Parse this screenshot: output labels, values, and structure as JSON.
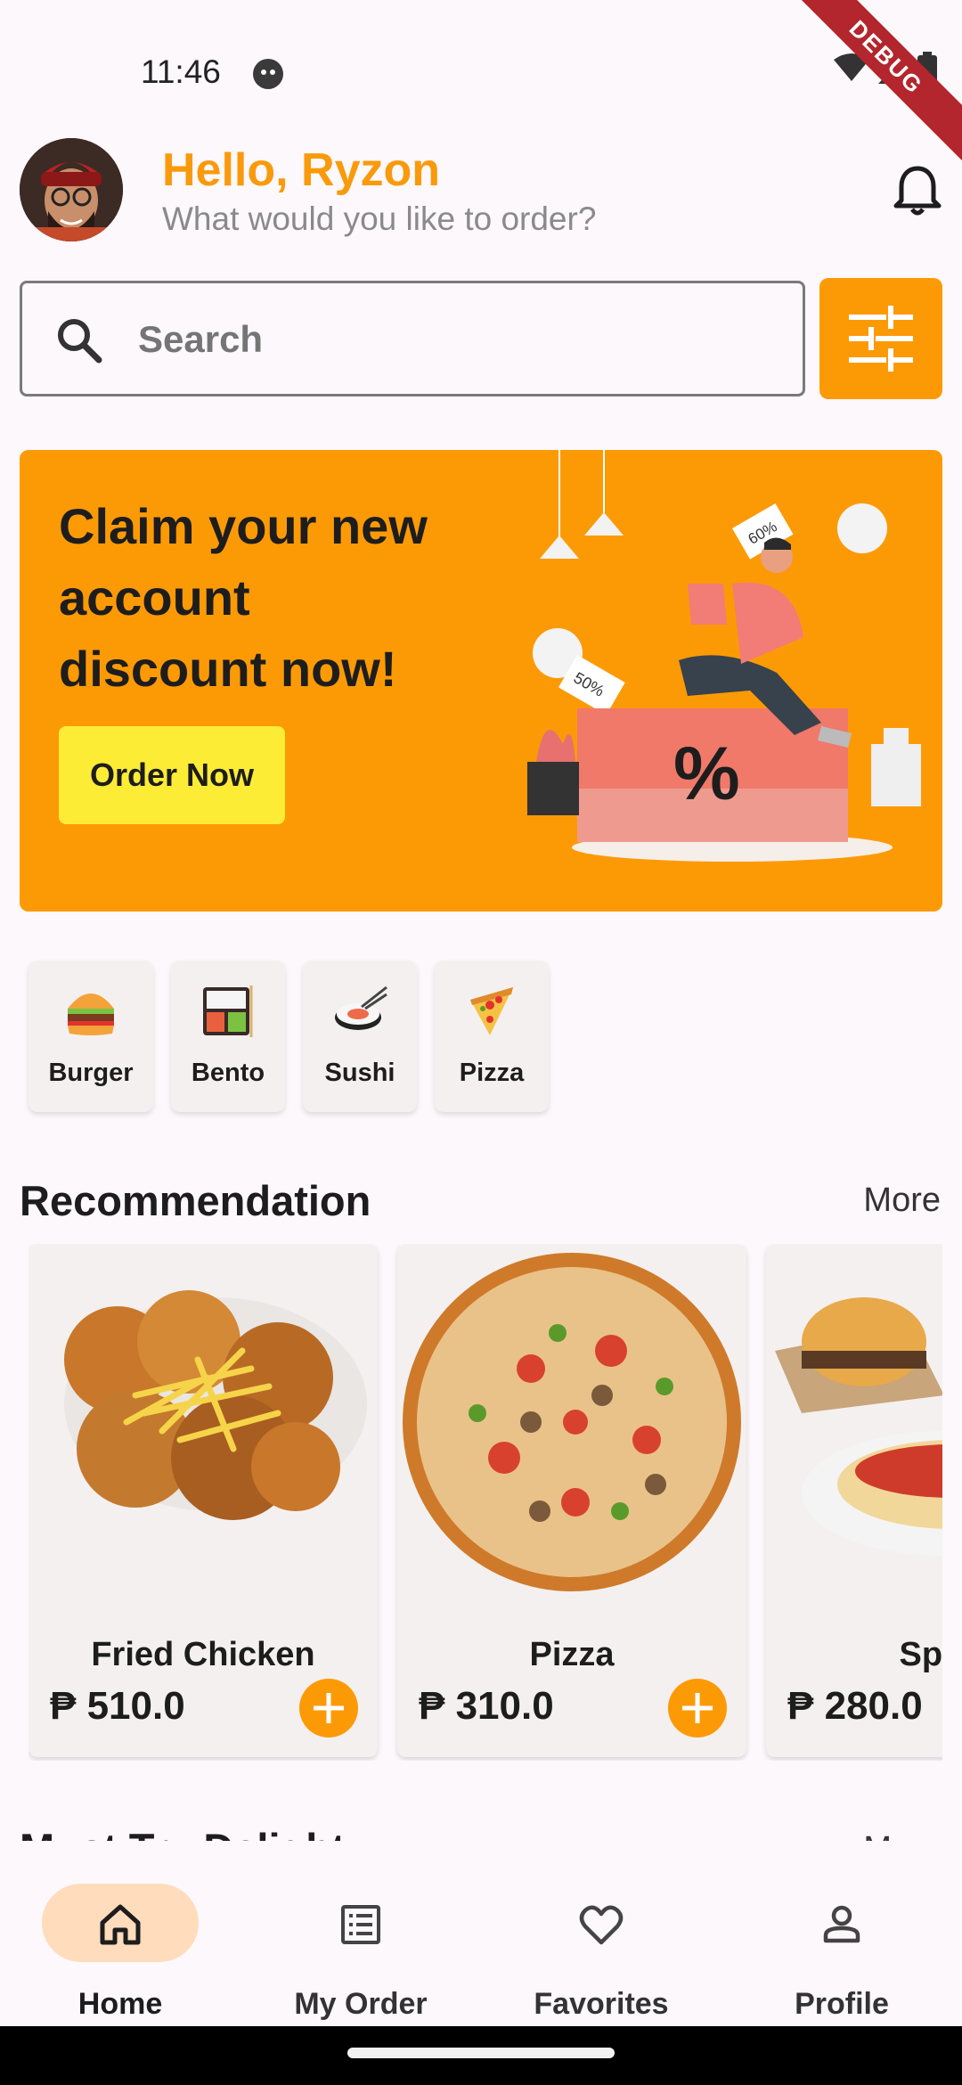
{
  "status_bar": {
    "time": "11:46",
    "debug_label": "DEBUG"
  },
  "header": {
    "greeting": "Hello, Ryzon",
    "subtitle": "What would you like to order?"
  },
  "search": {
    "placeholder": "Search"
  },
  "banner": {
    "title": "Claim your new account discount now!",
    "button_label": "Order Now",
    "tag_60": "60%",
    "tag_50": "50%",
    "percent_sign": "%"
  },
  "categories": [
    {
      "label": "Burger",
      "icon": "burger-icon"
    },
    {
      "label": "Bento",
      "icon": "bento-icon"
    },
    {
      "label": "Sushi",
      "icon": "sushi-icon"
    },
    {
      "label": "Pizza",
      "icon": "pizza-icon"
    }
  ],
  "recommendation": {
    "title": "Recommendation",
    "more_label": "More",
    "items": [
      {
        "name": "Fried Chicken",
        "price": "₱ 510.0"
      },
      {
        "name": "Pizza",
        "price": "₱ 310.0"
      },
      {
        "name": "Spag",
        "price": "₱ 280.0"
      }
    ]
  },
  "must_try": {
    "title": "Must Try Delight",
    "more_label": "More"
  },
  "bottom_nav": [
    {
      "label": "Home",
      "icon": "home-icon",
      "active": true
    },
    {
      "label": "My Order",
      "icon": "order-list-icon",
      "active": false
    },
    {
      "label": "Favorites",
      "icon": "heart-icon",
      "active": false
    },
    {
      "label": "Profile",
      "icon": "person-icon",
      "active": false
    }
  ],
  "colors": {
    "accent": "#fc9a06",
    "greeting": "#f99a0c",
    "banner_button": "#fcec36",
    "nav_active_pill": "#ffdcbc"
  }
}
